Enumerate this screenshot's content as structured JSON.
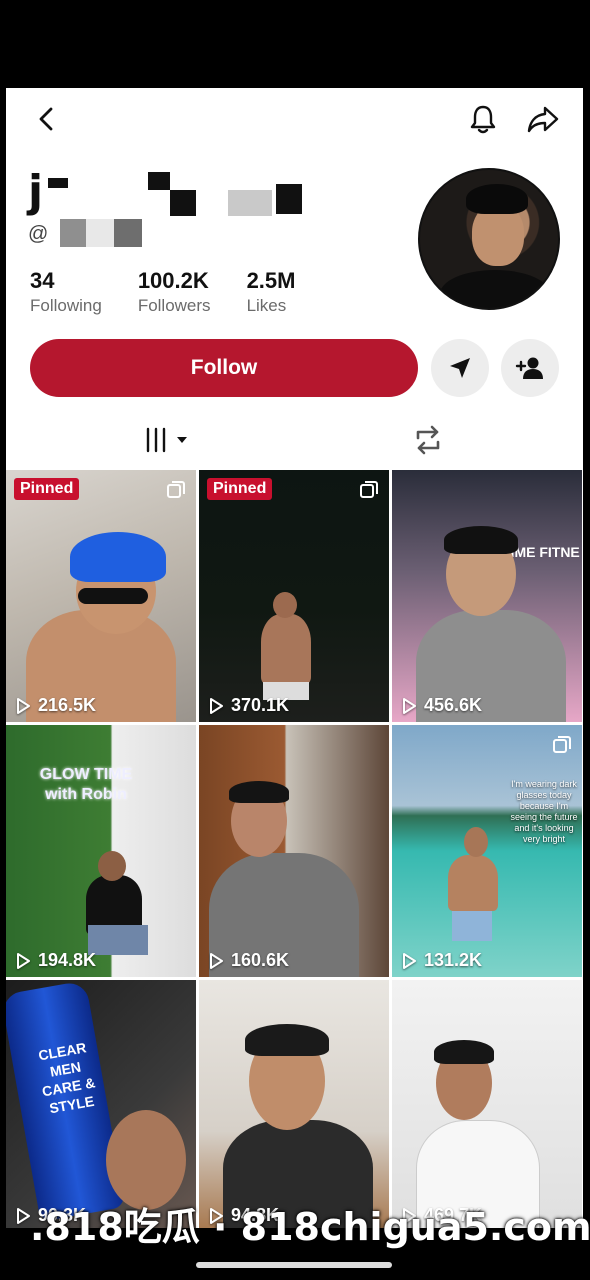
{
  "header": {
    "back_icon": "chevron-left-icon",
    "bell_icon": "bell-icon",
    "share_icon": "share-arrow-icon"
  },
  "profile": {
    "name_visible_prefix": "j",
    "handle_prefix": "@"
  },
  "stats": [
    {
      "value": "34",
      "label": "Following"
    },
    {
      "value": "100.2K",
      "label": "Followers"
    },
    {
      "value": "2.5M",
      "label": "Likes"
    }
  ],
  "actions": {
    "follow_label": "Follow",
    "follow_color": "#b5172e",
    "message_icon": "send-icon",
    "add_friend_icon": "add-user-icon"
  },
  "tabs": {
    "videos_icon": "grid-columns-icon",
    "reposts_icon": "repost-icon"
  },
  "pinned_label": "Pinned",
  "videos": [
    {
      "views": "216.5K",
      "pinned": true,
      "multi": true
    },
    {
      "views": "370.1K",
      "pinned": true,
      "multi": true
    },
    {
      "views": "456.6K",
      "pinned": false,
      "multi": false,
      "overlay_text": "TIME FITNE"
    },
    {
      "views": "194.8K",
      "pinned": false,
      "multi": false,
      "overlay_text": "GLOW TIME with Robin"
    },
    {
      "views": "160.6K",
      "pinned": false,
      "multi": false
    },
    {
      "views": "131.2K",
      "pinned": false,
      "multi": true,
      "caption": "I'm wearing dark glasses today because I'm seeing the future and it's looking very bright"
    },
    {
      "views": "90.3K",
      "pinned": false,
      "multi": false,
      "overlay_text": "CLEAR MEN CARE & STYLE"
    },
    {
      "views": "94.8K",
      "pinned": false,
      "multi": false
    },
    {
      "views": "469.7K",
      "pinned": false,
      "multi": false
    }
  ],
  "watermark": ".818吃瓜 · 818chigua5.com"
}
